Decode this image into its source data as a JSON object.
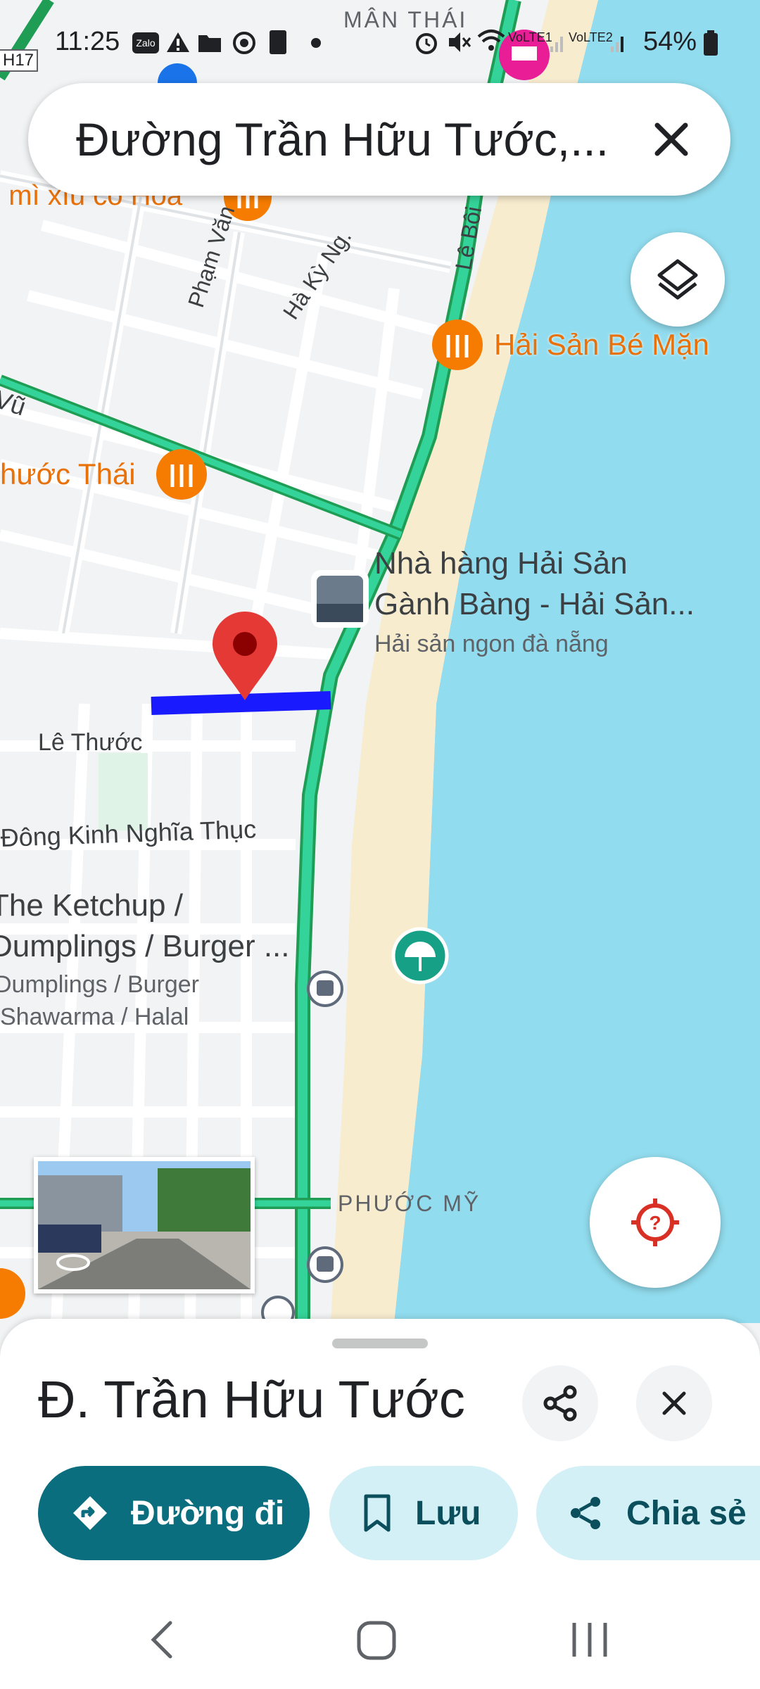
{
  "status_bar": {
    "time": "11:25",
    "zalo": "Zalo",
    "sim1": "VoLTE1",
    "sim2": "VoLTE2",
    "battery": "54%",
    "icons": [
      "zalo-icon",
      "alert-icon",
      "folder-icon",
      "screen-recorder-icon",
      "sim-icon",
      "alarm-icon",
      "mute-icon",
      "wifi-icon",
      "signal-icon",
      "battery-icon"
    ]
  },
  "map": {
    "labels": {
      "man_thai": "MÂN THÁI",
      "hai_san_be_man": "Hải Sản Bé Mặn",
      "phuoc_thai": "hước Thái",
      "mi_xiu": "ı mì xíu cô Hoa",
      "pham_van": "Phạm Văn",
      "ha_ky_ng": "Hà Kỳ Ng.",
      "le_boi": "Lê Bôi",
      "vu": "Vũ",
      "gb_line1": "Nhà hàng Hải Sản",
      "gb_line2": "Gành Bàng - Hải Sản...",
      "gb_sub": "Hải sản ngon đà nẵng",
      "le_thuoc": "Lê Thước",
      "dong_kinh": "Đông Kinh Nghĩa Thục",
      "ketchup1": "The Ketchup /",
      "ketchup2": "Dumplings / Burger ...",
      "ketchup3": "Dumplings / Burger",
      "ketchup4": "Shawarma / Halal",
      "phuoc_my": "PHƯỚC MỸ",
      "h17": "H17"
    },
    "accent_route": "#1a1aff",
    "highway_color": "#34d399",
    "sea_color": "#91dcee",
    "pin_color": "#e53935"
  },
  "search": {
    "query": "Đường Trần Hữu Tước,...",
    "clear_icon": "close-icon"
  },
  "controls": {
    "layers_icon": "layers-icon",
    "location_icon": "my-location-icon"
  },
  "place_sheet": {
    "title": "Đ. Trần Hữu Tước",
    "share_icon": "share-icon",
    "close_icon": "close-icon",
    "actions": [
      {
        "label": "Đường đi",
        "icon": "directions-icon"
      },
      {
        "label": "Lưu",
        "icon": "bookmark-icon"
      },
      {
        "label": "Chia sẻ",
        "icon": "share-icon"
      }
    ]
  },
  "nav": {
    "icons": [
      "back-icon",
      "home-icon",
      "recents-icon"
    ]
  }
}
